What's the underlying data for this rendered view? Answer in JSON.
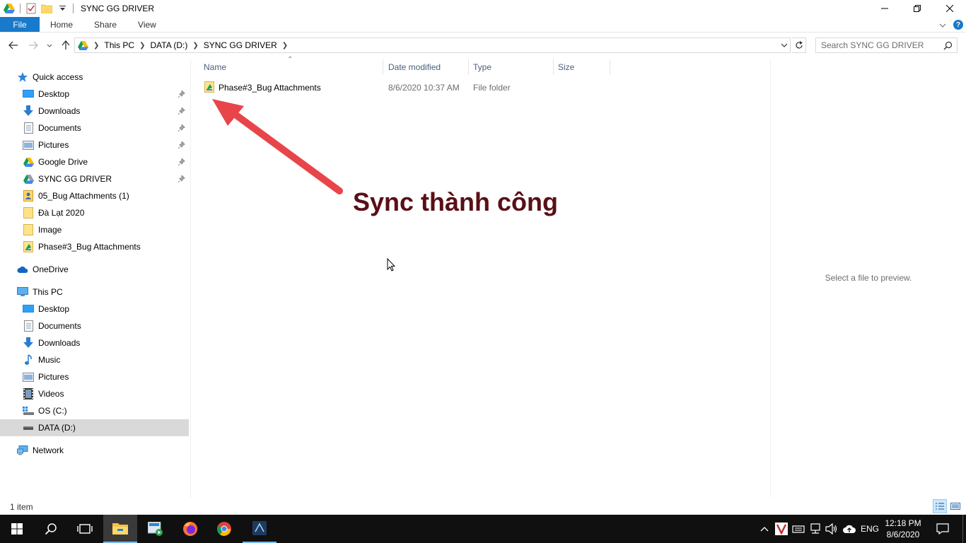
{
  "window": {
    "title": "SYNC GG DRIVER"
  },
  "ribbon": {
    "tabs": [
      "File",
      "Home",
      "Share",
      "View"
    ]
  },
  "address": {
    "crumbs": [
      "This PC",
      "DATA (D:)",
      "SYNC GG DRIVER"
    ],
    "search_placeholder": "Search SYNC GG DRIVER"
  },
  "nav": {
    "quick_access": "Quick access",
    "qa_items": [
      "Desktop",
      "Downloads",
      "Documents",
      "Pictures",
      "Google Drive",
      "SYNC GG DRIVER",
      "05_Bug Attachments (1)",
      "Đà Lạt 2020",
      "Image",
      "Phase#3_Bug Attachments"
    ],
    "onedrive": "OneDrive",
    "this_pc": "This PC",
    "pc_items": [
      "Desktop",
      "Documents",
      "Downloads",
      "Music",
      "Pictures",
      "Videos",
      "OS (C:)",
      "DATA (D:)"
    ],
    "network": "Network",
    "selected": "DATA (D:)"
  },
  "columns": [
    "Name",
    "Date modified",
    "Type",
    "Size"
  ],
  "files": [
    {
      "name": "Phase#3_Bug Attachments",
      "date": "8/6/2020 10:37 AM",
      "type": "File folder",
      "size": ""
    }
  ],
  "preview": {
    "text": "Select a file to preview."
  },
  "annotation": {
    "text": "Sync thành công",
    "color": "#5a0f17",
    "arrow_color": "#e8454a"
  },
  "status": {
    "item_count": "1 item"
  },
  "taskbar": {
    "lang": "ENG",
    "time": "12:18 PM",
    "date": "8/6/2020"
  },
  "colors": {
    "accent": "#1979ca",
    "taskbar": "#101010",
    "selected_nav": "#d9d9d9"
  }
}
